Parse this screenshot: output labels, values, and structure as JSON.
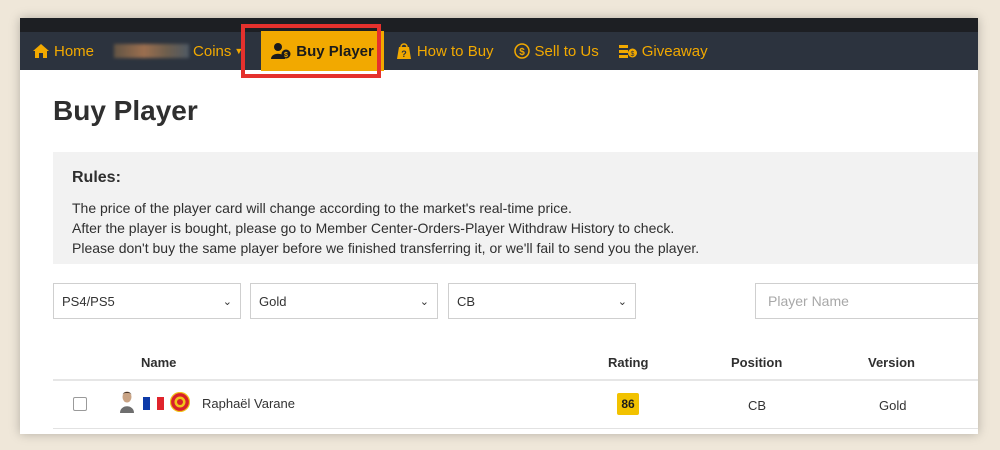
{
  "nav": {
    "items": [
      {
        "label": "Home",
        "icon": "home-icon"
      },
      {
        "label": "Coins",
        "icon": "blurred-logo"
      },
      {
        "label": "Buy Player",
        "icon": "user-coin-icon",
        "active": true
      },
      {
        "label": "How to Buy",
        "icon": "question-bag-icon"
      },
      {
        "label": "Sell to Us",
        "icon": "dollar-circle-icon"
      },
      {
        "label": "Giveaway",
        "icon": "coins-stack-icon"
      }
    ],
    "accent_color": "#f2a900",
    "bar_color": "#2c333e",
    "highlight_color": "#e5312d"
  },
  "page": {
    "title": "Buy Player"
  },
  "rules": {
    "title": "Rules:",
    "lines": [
      "The price of the player card will change according to the market's real-time price.",
      "After the player is bought, please go to Member Center-Orders-Player Withdraw History to check.",
      "Please don't buy the same player before we finished transferring it, or we'll fail to send you the player."
    ]
  },
  "filters": {
    "platform": "PS4/PS5",
    "quality": "Gold",
    "position": "CB",
    "search_placeholder": "Player Name"
  },
  "table": {
    "headers": {
      "name": "Name",
      "rating": "Rating",
      "position": "Position",
      "version": "Version"
    },
    "rows": [
      {
        "name": "Raphaël Varane",
        "rating": "86",
        "position": "CB",
        "version": "Gold",
        "nation": "France",
        "club": "Manchester United",
        "rating_color": "#f2c200"
      }
    ]
  }
}
